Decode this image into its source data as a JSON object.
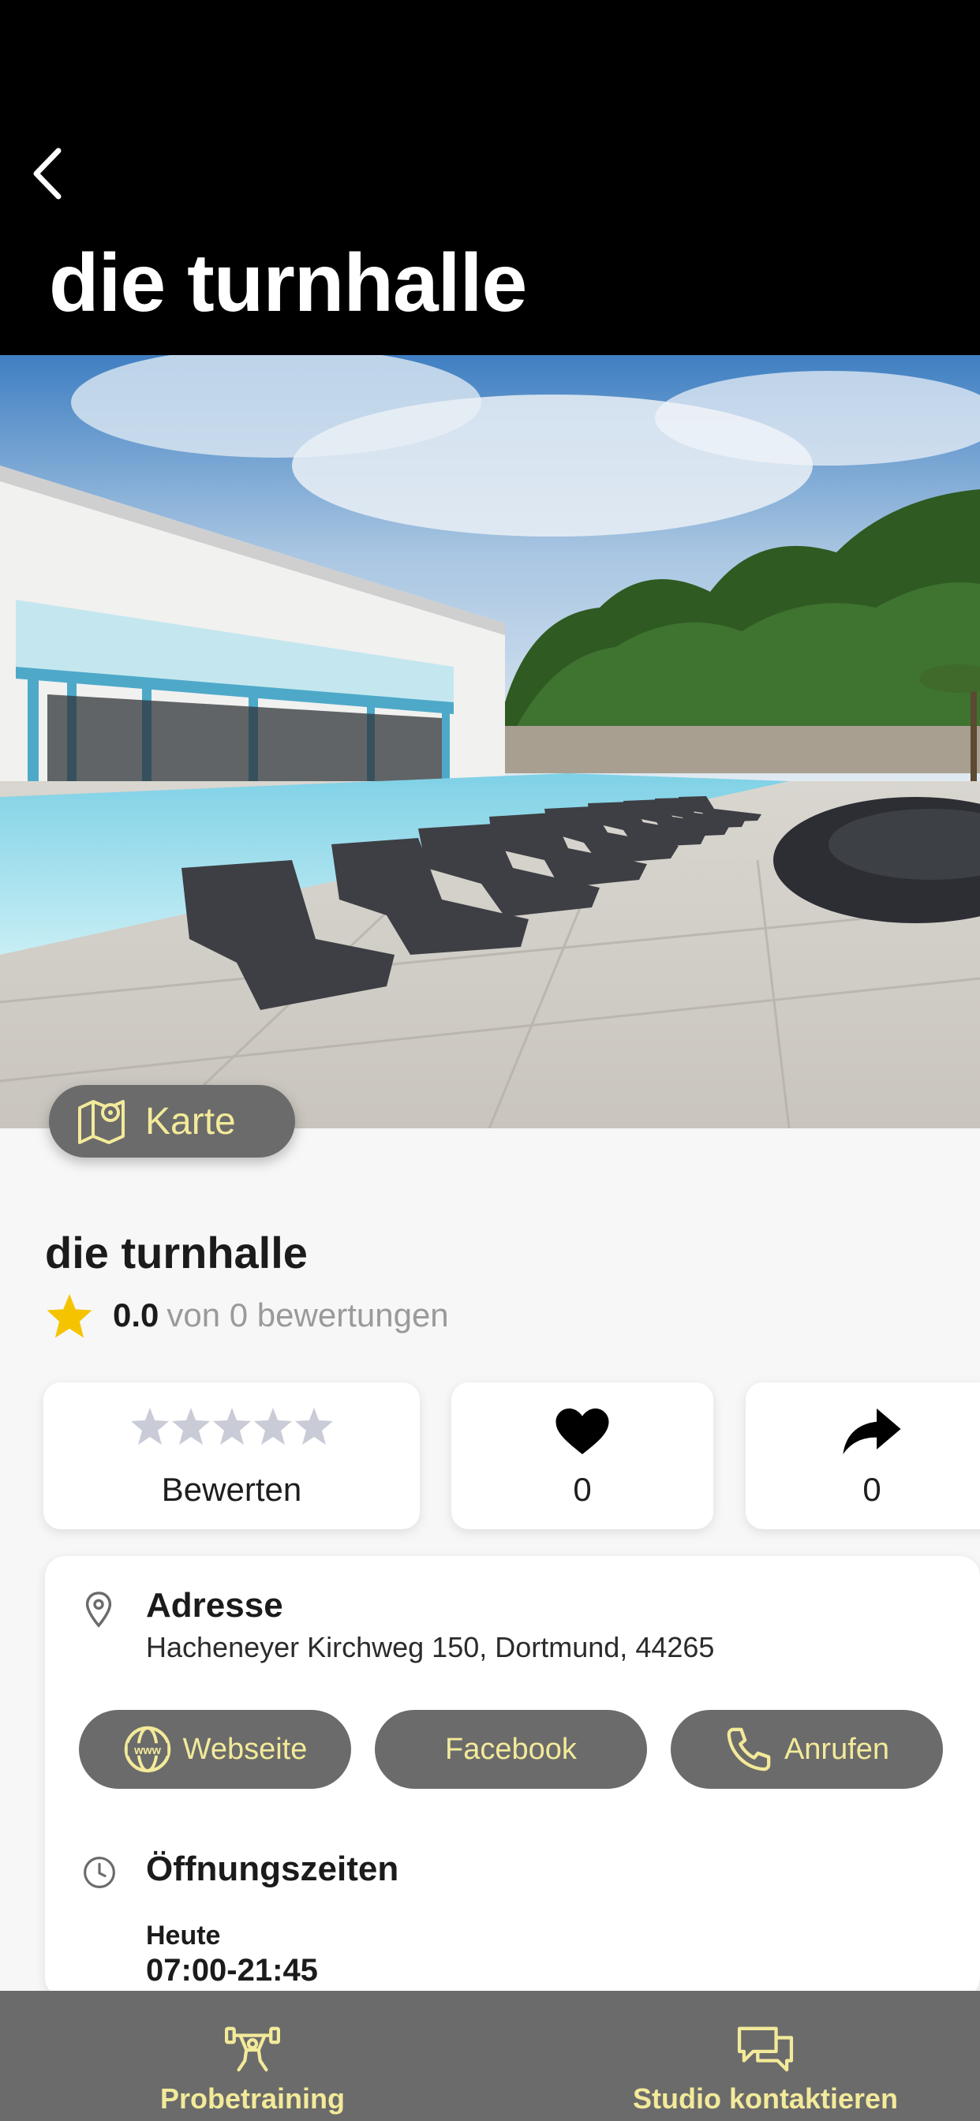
{
  "header": {
    "title": "die turnhalle"
  },
  "map_button": {
    "label": "Karte"
  },
  "studio": {
    "name": "die turnhalle",
    "rating_score": "0.0",
    "rating_count_text": "von 0 bewertungen"
  },
  "actions": {
    "rate_label": "Bewerten",
    "likes": "0",
    "shares": "0"
  },
  "info": {
    "address_title": "Adresse",
    "address_value": "Hacheneyer Kirchweg 150, Dortmund, 44265",
    "website_label": "Webseite",
    "facebook_label": "Facebook",
    "call_label": "Anrufen",
    "hours_title": "Öffnungszeiten",
    "today_label": "Heute",
    "today_hours": "07:00-21:45"
  },
  "bottom_nav": {
    "trial_label": "Probetraining",
    "contact_label": "Studio kontaktieren"
  },
  "colors": {
    "accent": "#f3ea9a",
    "pill": "#6b6b6b",
    "star": "#f5c400"
  }
}
